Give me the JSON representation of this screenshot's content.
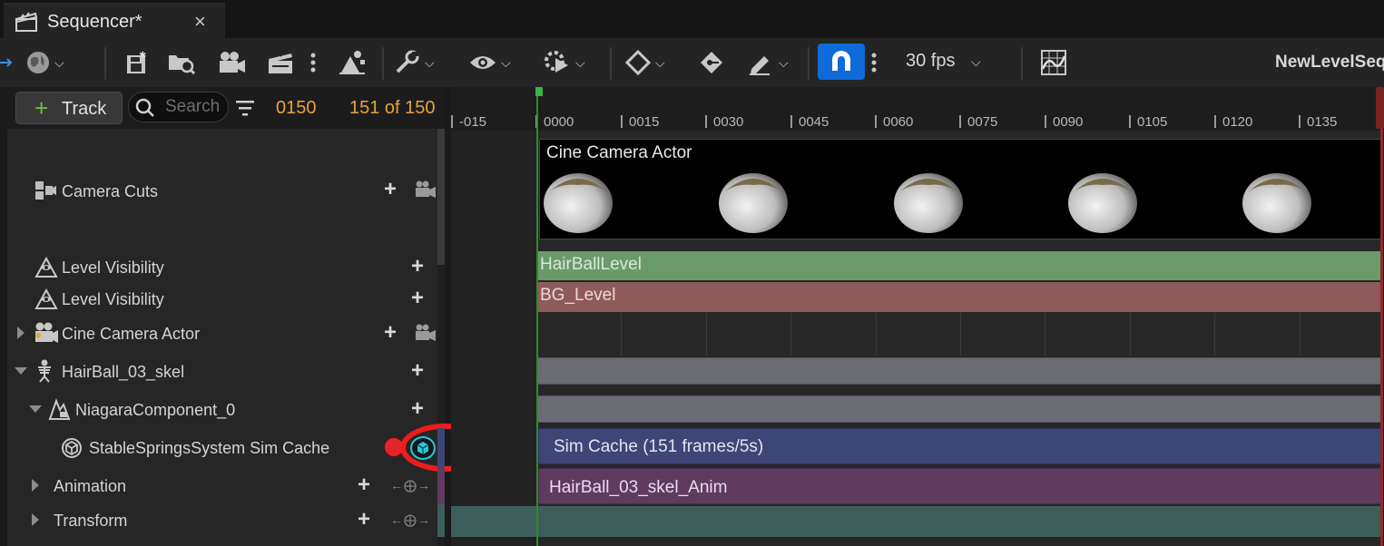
{
  "tab": {
    "title": "Sequencer*",
    "close": "×"
  },
  "toolbar": {
    "fps": "30 fps",
    "sequence_name": "NewLevelSequ"
  },
  "colors": {
    "accent": "#0e6bd9",
    "frame_orange": "#e8a33a",
    "hairball_level": "#6a9a6a",
    "bg_level": "#8e5a5a",
    "sim_cache": "#3e4577",
    "anim": "#5f3b5f",
    "transform": "#3d5e5a",
    "record_red": "#e0262a",
    "cache_cyan": "#2cc6d0",
    "highlight_ring": "#ef1c1c"
  },
  "left": {
    "add_track": "Track",
    "search_placeholder": "Search",
    "current_frame": "0150",
    "frame_count": "151 of 150"
  },
  "tracks": [
    {
      "label": "Camera Cuts",
      "icon": "camera-cuts-icon"
    },
    {
      "label": "Level Visibility",
      "icon": "level-visibility-icon"
    },
    {
      "label": "Level Visibility",
      "icon": "level-visibility-icon"
    },
    {
      "label": "Cine Camera Actor",
      "icon": "cine-camera-icon"
    },
    {
      "label": "HairBall_03_skel",
      "icon": "skeleton-icon"
    },
    {
      "label": "NiagaraComponent_0",
      "icon": "niagara-icon"
    },
    {
      "label": "StableSpringsSystem Sim Cache",
      "icon": "sim-cache-icon"
    },
    {
      "label": "Animation",
      "icon": ""
    },
    {
      "label": "Transform",
      "icon": ""
    }
  ],
  "ruler": {
    "ticks": [
      "-015",
      "0000",
      "0015",
      "0030",
      "0045",
      "0060",
      "0075",
      "0090",
      "0105",
      "0120",
      "0135"
    ]
  },
  "sections": {
    "camera": "Cine Camera Actor",
    "hairball_level": "HairBallLevel",
    "bg_level": "BG_Level",
    "sim_cache": "Sim Cache (151 frames/5s)",
    "anim": "HairBall_03_skel_Anim"
  }
}
